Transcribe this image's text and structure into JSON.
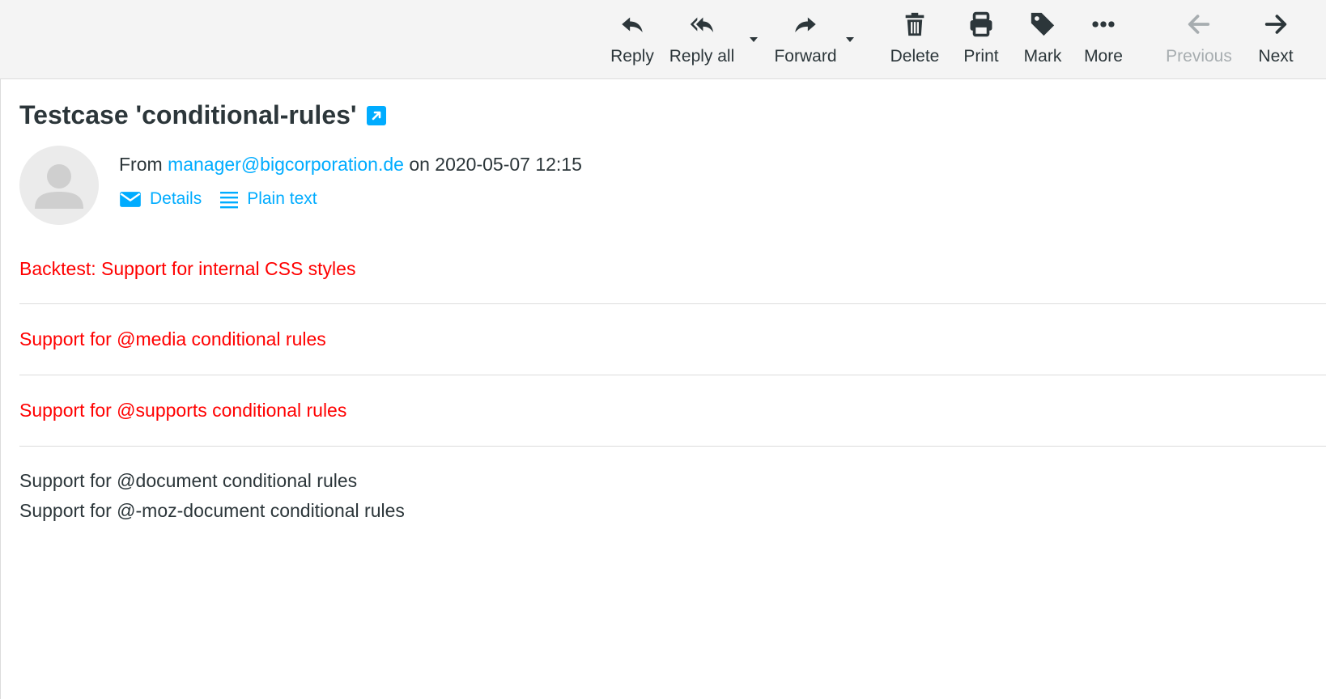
{
  "toolbar": {
    "reply": "Reply",
    "reply_all": "Reply all",
    "forward": "Forward",
    "delete": "Delete",
    "print": "Print",
    "mark": "Mark",
    "more": "More",
    "previous": "Previous",
    "next": "Next"
  },
  "message": {
    "subject": "Testcase 'conditional-rules'",
    "from_prefix": "From",
    "from_email": "manager@bigcorporation.de",
    "date_text": "on 2020-05-07 12:15",
    "details_link": "Details",
    "plain_text_link": "Plain text"
  },
  "body": {
    "lines": [
      "Backtest: Support for internal CSS styles",
      "Support for @media conditional rules",
      "Support for @supports conditional rules",
      "Support for @document conditional rules",
      "Support for @-moz-document conditional rules"
    ]
  },
  "colors": {
    "link": "#00acff",
    "highlight_text": "#ff0000",
    "text": "#2c363a",
    "toolbar_bg": "#f4f4f4"
  }
}
